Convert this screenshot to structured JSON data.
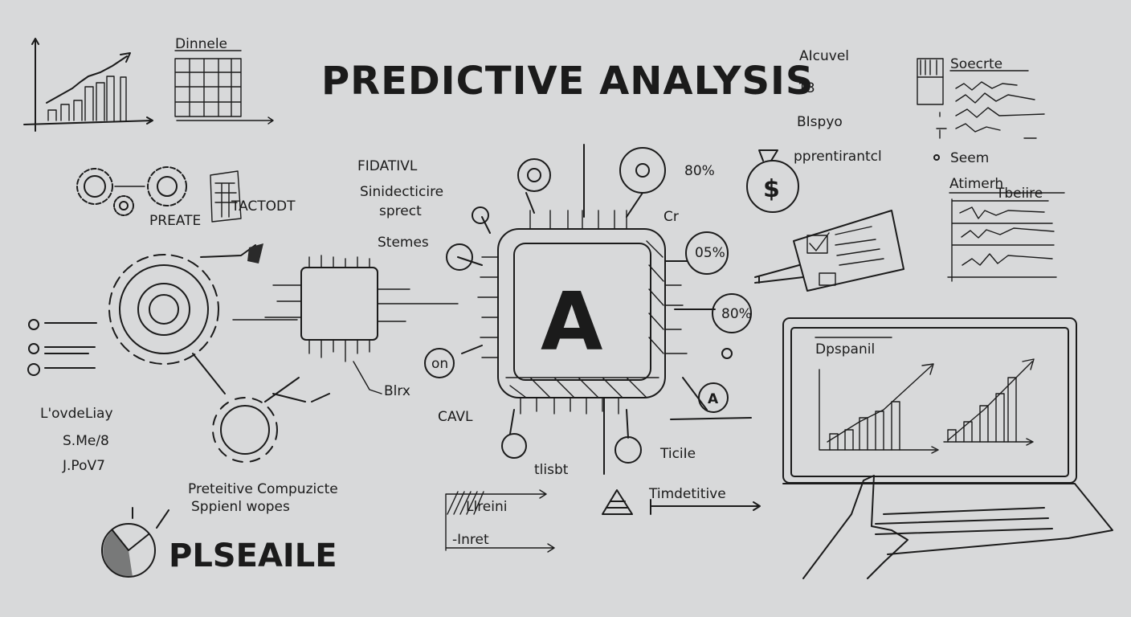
{
  "title": "PREDICTIVE ANALYSIS",
  "labels": {
    "dinnele": "Dinnele",
    "preate": "PREATE",
    "tactodt": "TACTODT",
    "fidativl": "FIDATIVL",
    "sinidecticire": "Sinidecticire",
    "sprect": "sprect",
    "stemes": "Stemes",
    "aicuvel": "AIcuvel",
    "num13": "13",
    "bispyo": "BIspyo",
    "soecrte": "Soecrte",
    "seem": "Seem",
    "prentirantcl": "pprentirantcl",
    "atimerh": "Atimerh",
    "tbeiire": "Tbeiire",
    "pct1": "80%",
    "pct2": "05%",
    "pct3": "80%",
    "on": "on",
    "a_small": "A",
    "chip_letter": "A",
    "dpspanil": "Dpspanil",
    "blrx": "Blrx",
    "cavl": "CAVL",
    "ticiie": "TiciIe",
    "tlisbt": "tlisbt",
    "ovdeliay": "L'ovdeLiay",
    "sme8": "S.Me/8",
    "jpov7": "J.PoV7",
    "compuzicte": "Preteitive Compuzicte",
    "sppienl": "Sppienl wopes",
    "plseaile": "PLSEAILE",
    "llreini": "Llreini",
    "inret": "-Inret",
    "timdetitive": "Timdetitive",
    "cr": "Cr"
  },
  "colors": {
    "background": "#d8d9da",
    "ink": "#1b1b1b"
  }
}
